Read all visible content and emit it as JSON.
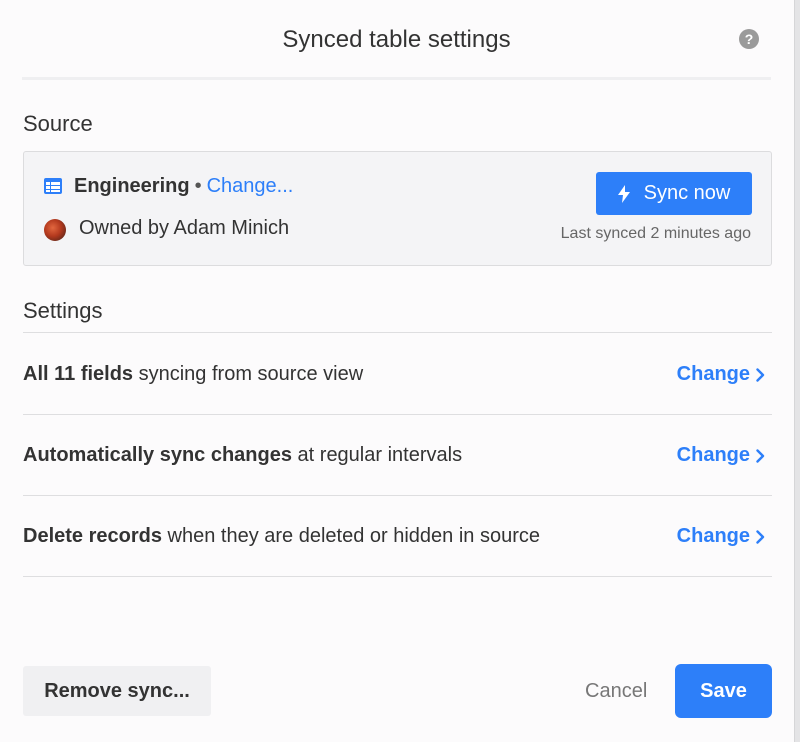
{
  "dialog": {
    "title": "Synced table settings",
    "help_icon": "question-icon"
  },
  "source": {
    "section_title": "Source",
    "table_name": "Engineering",
    "separator": "•",
    "change_label": "Change...",
    "owner_text": "Owned by Adam Minich",
    "sync_button_label": "Sync now",
    "last_synced": "Last synced 2 minutes ago"
  },
  "settings": {
    "section_title": "Settings",
    "rows": [
      {
        "bold": "All 11 fields",
        "rest": " syncing from source view",
        "change_label": "Change"
      },
      {
        "bold": "Automatically sync changes",
        "rest": " at regular intervals",
        "change_label": "Change"
      },
      {
        "bold": "Delete records",
        "rest": " when they are deleted or hidden in source",
        "change_label": "Change"
      }
    ]
  },
  "footer": {
    "remove_label": "Remove sync...",
    "cancel_label": "Cancel",
    "save_label": "Save"
  },
  "colors": {
    "accent": "#2d7ff9",
    "text": "#333333",
    "muted": "#666666"
  }
}
